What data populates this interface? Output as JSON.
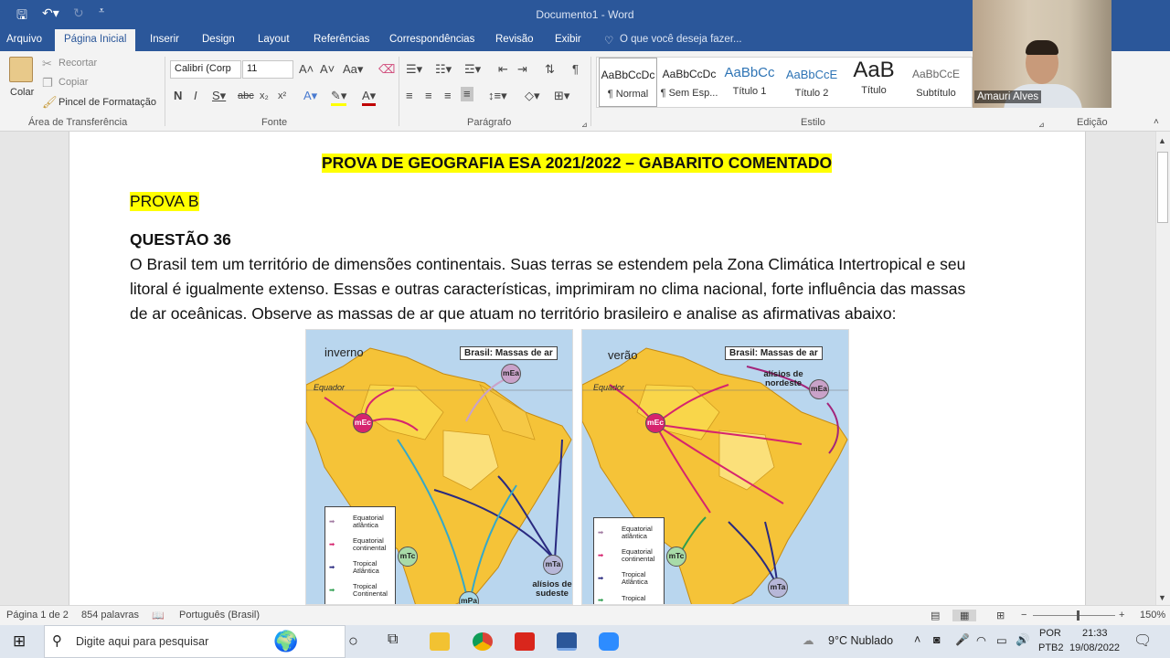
{
  "titlebar": {
    "document_title": "Documento1 - Word",
    "save_icon": "save-icon",
    "undo_icon": "undo-icon",
    "redo_icon": "redo-icon"
  },
  "tabs": [
    {
      "label": "Arquivo"
    },
    {
      "label": "Página Inicial"
    },
    {
      "label": "Inserir"
    },
    {
      "label": "Design"
    },
    {
      "label": "Layout"
    },
    {
      "label": "Referências"
    },
    {
      "label": "Correspondências"
    },
    {
      "label": "Revisão"
    },
    {
      "label": "Exibir"
    }
  ],
  "tell_me": "O que você deseja fazer...",
  "clipboard": {
    "paste": "Colar",
    "cut": "Recortar",
    "copy": "Copiar",
    "format_painter": "Pincel de Formatação",
    "group": "Área de Transferência"
  },
  "font": {
    "name": "Calibri (Corp",
    "size": "11",
    "group": "Fonte"
  },
  "paragraph": {
    "group": "Parágrafo"
  },
  "styles": {
    "group": "Estilo",
    "items": [
      {
        "preview": "AaBbCcDc",
        "name": "¶ Normal"
      },
      {
        "preview": "AaBbCcDc",
        "name": "¶ Sem Esp..."
      },
      {
        "preview": "AaBbCc",
        "name": "Título 1"
      },
      {
        "preview": "AaBbCcE",
        "name": "Título 2"
      },
      {
        "preview": "AaB",
        "name": "Título"
      },
      {
        "preview": "AaBbCcE",
        "name": "Subtítulo"
      }
    ]
  },
  "editing": {
    "group": "Edição"
  },
  "webcam": {
    "name": "Amauri Alves"
  },
  "document": {
    "heading": "PROVA DE GEOGRAFIA ESA 2021/2022 – GABARITO COMENTADO",
    "subheading": "PROVA B",
    "question": "QUESTÃO 36",
    "line1": "O Brasil tem um território de dimensões continentais. Suas terras se estendem pela Zona Climática Intertropical e seu",
    "line2": "litoral é igualmente extenso. Essas e outras características, imprimiram no clima nacional, forte influência das massas",
    "line3": "de ar oceânicas. Observe as massas de ar que atuam no território brasileiro e analise as afirmativas abaixo:"
  },
  "maps": [
    {
      "season": "inverno",
      "title": "Brasil: Massas de ar",
      "equator": "Equador",
      "masses": [
        "mEa",
        "mEc",
        "mTc",
        "mTa",
        "mPa"
      ],
      "annotation": "alísios de sudeste",
      "legend": [
        "Equatorial atlântica",
        "Equatorial continental",
        "Tropical Atlântica",
        "Tropical Continental"
      ]
    },
    {
      "season": "verão",
      "title": "Brasil: Massas de ar",
      "equator": "Equador",
      "masses": [
        "mEa",
        "mEc",
        "mTc",
        "mTa"
      ],
      "annotation": "alísios de nordeste",
      "legend": [
        "Equatorial atlântica",
        "Equatorial continental",
        "Tropical Atlântica",
        "Tropical"
      ]
    }
  ],
  "statusbar": {
    "page": "Página 1 de 2",
    "words": "854 palavras",
    "language": "Português (Brasil)",
    "zoom": "150%",
    "zoom_minus": "−",
    "zoom_plus": "+"
  },
  "taskbar": {
    "search_placeholder": "Digite aqui para pesquisar",
    "weather": "9°C  Nublado",
    "lang1": "POR",
    "lang2": "PTB2",
    "time": "21:33",
    "date": "19/08/2022"
  },
  "colors": {
    "word_blue": "#2b579a",
    "highlight": "#ffff00",
    "equatorial_atlantica": "#c9a2c9",
    "equatorial_continental": "#d6246e",
    "tropical_atlantica": "#2a2a80",
    "tropical_continental": "#2e9e4f"
  }
}
